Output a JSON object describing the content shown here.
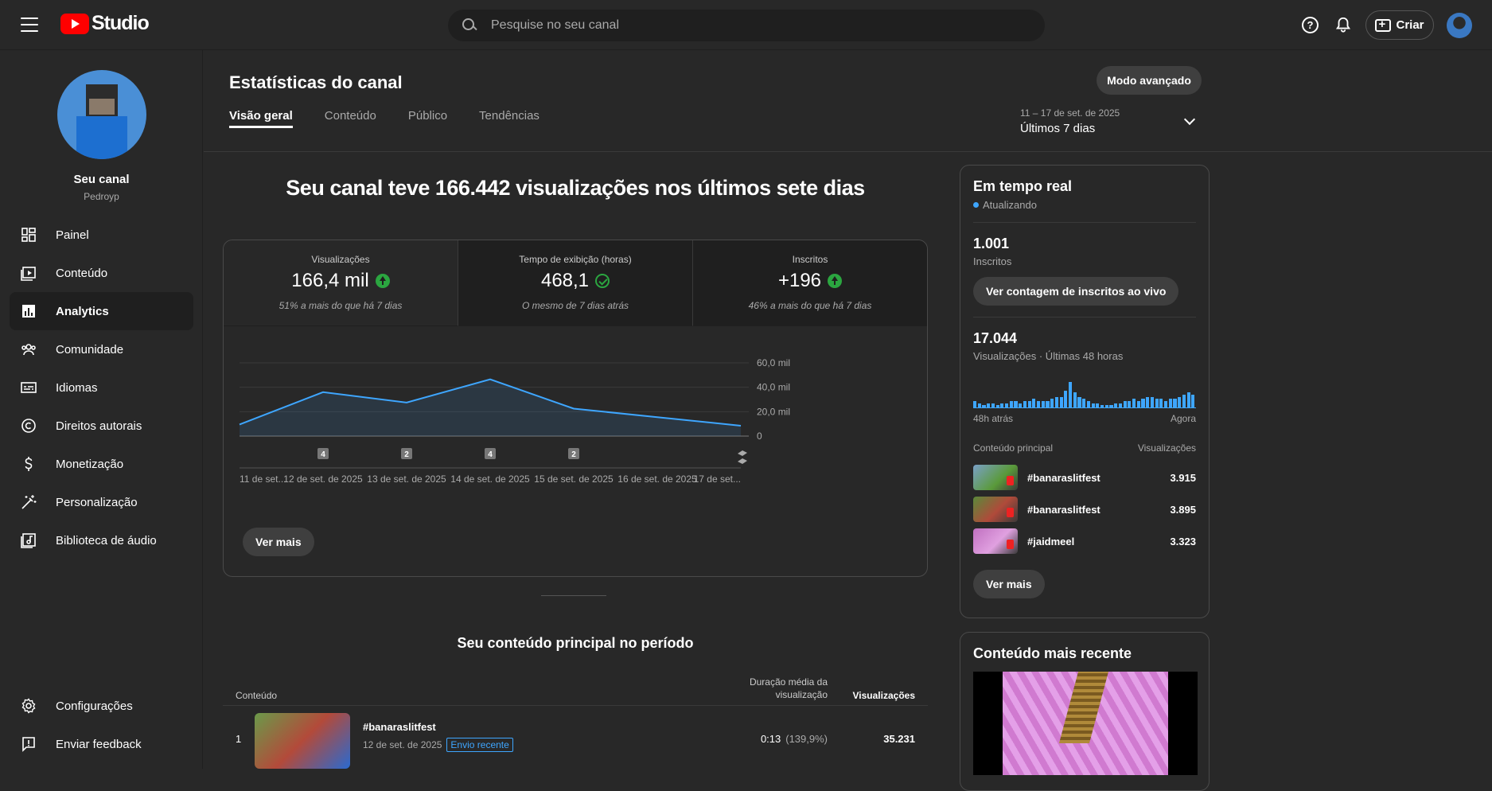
{
  "topbar": {
    "logo_text": "Studio",
    "search_placeholder": "Pesquise no seu canal",
    "create_label": "Criar"
  },
  "sidebar": {
    "channel_name": "Seu canal",
    "channel_handle": "Pedroyp",
    "items": [
      {
        "label": "Painel",
        "icon": "dashboard-icon"
      },
      {
        "label": "Conteúdo",
        "icon": "content-icon"
      },
      {
        "label": "Analytics",
        "icon": "analytics-icon"
      },
      {
        "label": "Comunidade",
        "icon": "community-icon"
      },
      {
        "label": "Idiomas",
        "icon": "subtitles-icon"
      },
      {
        "label": "Direitos autorais",
        "icon": "copyright-icon"
      },
      {
        "label": "Monetização",
        "icon": "dollar-icon"
      },
      {
        "label": "Personalização",
        "icon": "magic-wand-icon"
      },
      {
        "label": "Biblioteca de áudio",
        "icon": "audio-library-icon"
      }
    ],
    "bottom_items": [
      {
        "label": "Configurações",
        "icon": "gear-icon"
      },
      {
        "label": "Enviar feedback",
        "icon": "feedback-icon"
      }
    ],
    "active_item": "Analytics"
  },
  "main": {
    "title": "Estatísticas do canal",
    "advanced_button": "Modo avançado",
    "tabs": [
      {
        "label": "Visão geral"
      },
      {
        "label": "Conteúdo"
      },
      {
        "label": "Público"
      },
      {
        "label": "Tendências"
      }
    ],
    "date_range_sub": "11 – 17 de set. de 2025",
    "date_range_main": "Últimos 7 dias",
    "headline": "Seu canal teve 166.442 visualizações nos últimos sete dias",
    "metrics": [
      {
        "label": "Visualizações",
        "value": "166,4 mil",
        "sub": "51% a mais do que há 7 dias",
        "trend": "up"
      },
      {
        "label": "Tempo de exibição (horas)",
        "value": "468,1",
        "sub": "O mesmo de 7 dias atrás",
        "trend": "same"
      },
      {
        "label": "Inscritos",
        "value": "+196",
        "sub": "46% a mais do que há 7 dias",
        "trend": "up"
      }
    ],
    "see_more": "Ver mais",
    "top_content_title": "Seu conteúdo principal no período",
    "table": {
      "col_content": "Conteúdo",
      "col_duration": "Duração média da visualização",
      "col_views": "Visualizações",
      "rows": [
        {
          "rank": "1",
          "title": "#banaraslitfest",
          "date": "12 de set. de 2025",
          "badge": "Envio recente",
          "duration": "0:13",
          "duration_pct": "(139,9%)",
          "views": "35.231"
        }
      ]
    }
  },
  "chart_data": {
    "type": "area",
    "categories": [
      "11 de set...",
      "12 de set. de 2025",
      "13 de set. de 2025",
      "14 de set. de 2025",
      "15 de set. de 2025",
      "16 de set. de 2025",
      "17 de set..."
    ],
    "values": [
      9500,
      36000,
      27500,
      46500,
      22500,
      15500,
      8500
    ],
    "y_ticks": [
      "60,0 mil",
      "40,0 mil",
      "20,0 mil",
      "0"
    ],
    "ylim": [
      0,
      60000
    ],
    "upload_markers": [
      {
        "category": "12 de set. de 2025",
        "count": "4"
      },
      {
        "category": "13 de set. de 2025",
        "count": "2"
      },
      {
        "category": "14 de set. de 2025",
        "count": "4"
      },
      {
        "category": "15 de set. de 2025",
        "count": "2"
      }
    ],
    "color": "#3ea6ff"
  },
  "realtime": {
    "title": "Em tempo real",
    "status": "Atualizando",
    "subscribers": "1.001",
    "subscribers_label": "Inscritos",
    "live_count_button": "Ver contagem de inscritos ao vivo",
    "views": "17.044",
    "views_label": "Visualizações · Últimas 48 horas",
    "bars": [
      3,
      2,
      1,
      2,
      2,
      1,
      2,
      2,
      3,
      3,
      2,
      3,
      3,
      4,
      3,
      3,
      3,
      4,
      5,
      5,
      8,
      12,
      7,
      5,
      4,
      3,
      2,
      2,
      1,
      1,
      1,
      2,
      2,
      3,
      3,
      4,
      3,
      4,
      5,
      5,
      4,
      4,
      3,
      4,
      4,
      5,
      6,
      7,
      6
    ],
    "bars_start": "48h atrás",
    "bars_end": "Agora",
    "top_header_left": "Conteúdo principal",
    "top_header_right": "Visualizações",
    "top_items": [
      {
        "title": "#banaraslitfest",
        "views": "3.915"
      },
      {
        "title": "#banaraslitfest",
        "views": "3.895"
      },
      {
        "title": "#jaidmeel",
        "views": "3.323"
      }
    ],
    "see_more": "Ver mais"
  },
  "recent": {
    "title": "Conteúdo mais recente"
  }
}
